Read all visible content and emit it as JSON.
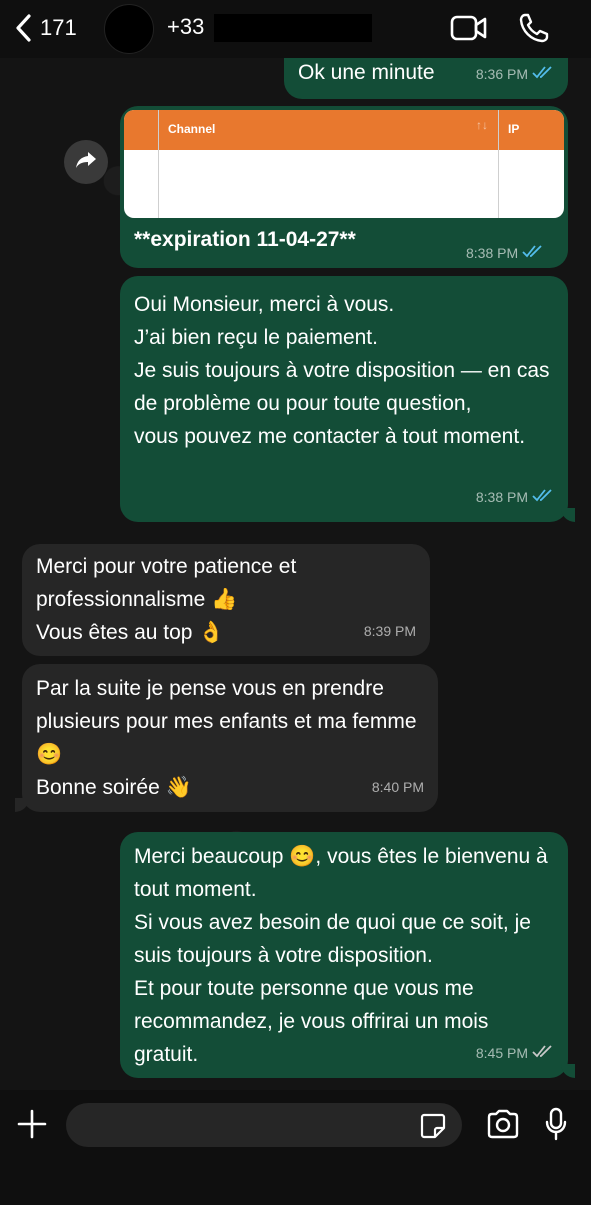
{
  "header": {
    "back_count": "171",
    "phone_prefix": "+33",
    "icons": {
      "back": "chevron-left-icon",
      "video": "video-camera-icon",
      "call": "phone-icon"
    }
  },
  "messages": [
    {
      "direction": "out",
      "text": "Ok une minute",
      "time": "8:36 PM",
      "read": true
    },
    {
      "direction": "out",
      "type": "forwarded-image",
      "table_headers": [
        "Channel",
        "IP"
      ],
      "sort_glyph": "↑↓",
      "text": "**expiration 11-04-27**",
      "time": "8:38 PM",
      "read": true
    },
    {
      "direction": "out",
      "text": "Oui Monsieur, merci à vous.\nJ’ai bien reçu le paiement.\nJe suis toujours à votre disposition — en cas de problème ou pour toute question,\nvous pouvez me contacter à tout moment.",
      "time": "8:38 PM",
      "read": true
    },
    {
      "direction": "in",
      "text": "Merci pour votre patience et professionnalisme 👍\nVous êtes au top 👌",
      "time": "8:39 PM"
    },
    {
      "direction": "in",
      "text": "Par la suite je pense vous en prendre plusieurs pour mes enfants et ma femme😊\nBonne soirée 👋",
      "time": "8:40 PM"
    },
    {
      "direction": "out",
      "text": "Merci beaucoup 😊, vous êtes le bienvenu à tout moment.\nSi vous avez besoin de quoi que ce soit, je suis toujours à votre disposition.\nEt pour toute personne que vous me recommandez, je vous offrirai un mois gratuit.",
      "time": "8:45 PM",
      "read": true
    }
  ],
  "colors": {
    "outgoing_bubble": "#134d37",
    "incoming_bubble": "#262626",
    "read_ticks": "#53bdeb",
    "table_header": "#e8782e"
  },
  "input": {
    "placeholder": "",
    "icons": [
      "plus-icon",
      "sticker-icon",
      "camera-icon",
      "microphone-icon"
    ]
  }
}
